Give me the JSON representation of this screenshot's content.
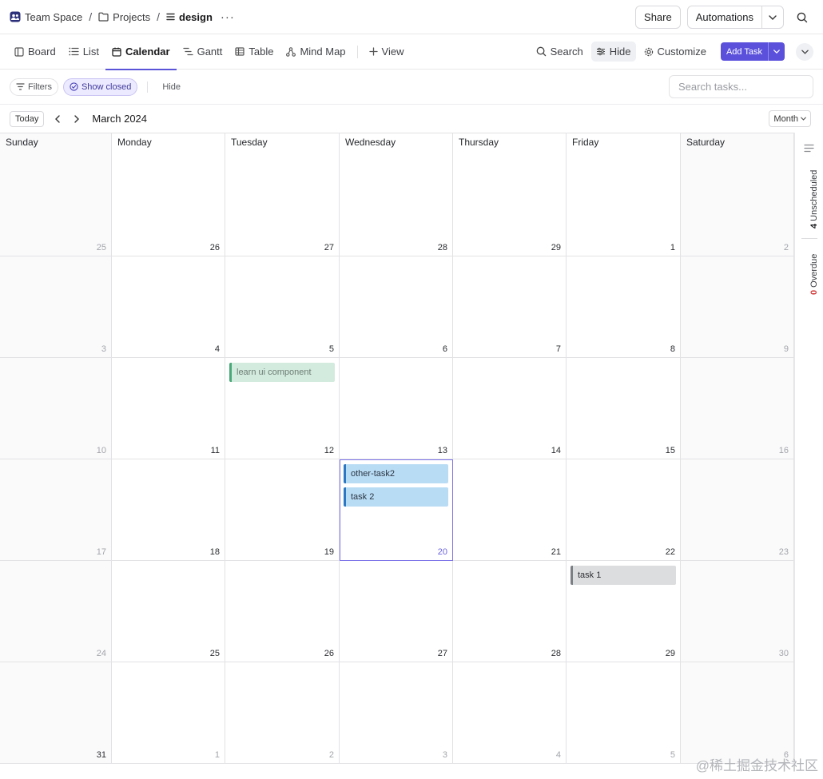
{
  "breadcrumb": {
    "space": "Team Space",
    "folder": "Projects",
    "list": "design",
    "separator": "/",
    "more": "···"
  },
  "topbar": {
    "share": "Share",
    "automations": "Automations"
  },
  "views": {
    "tabs": [
      "Board",
      "List",
      "Calendar",
      "Gantt",
      "Table",
      "Mind Map"
    ],
    "active": "Calendar",
    "add_view": "View"
  },
  "view_actions": {
    "search": "Search",
    "hide": "Hide",
    "customize": "Customize",
    "add_task": "Add Task"
  },
  "filters": {
    "filters": "Filters",
    "show_closed": "Show closed",
    "hide": "Hide",
    "search_placeholder": "Search tasks..."
  },
  "calendar": {
    "today_button": "Today",
    "title": "March 2024",
    "mode": "Month",
    "weekdays": [
      "Sunday",
      "Monday",
      "Tuesday",
      "Wednesday",
      "Thursday",
      "Friday",
      "Saturday"
    ],
    "weeks": [
      [
        "25",
        "26",
        "27",
        "28",
        "29",
        "1",
        "2"
      ],
      [
        "3",
        "4",
        "5",
        "6",
        "7",
        "8",
        "9"
      ],
      [
        "10",
        "11",
        "12",
        "13",
        "14",
        "15",
        "16"
      ],
      [
        "17",
        "18",
        "19",
        "20",
        "21",
        "22",
        "23"
      ],
      [
        "24",
        "25",
        "26",
        "27",
        "28",
        "29",
        "30"
      ],
      [
        "31",
        "1",
        "2",
        "3",
        "4",
        "5",
        "6"
      ]
    ],
    "events": {
      "tue_12": "learn ui component",
      "wed_20_a": "other-task2",
      "wed_20_b": "task 2",
      "fri_29": "task 1"
    }
  },
  "rail": {
    "unscheduled_count": "4",
    "unscheduled_label": "Unscheduled",
    "overdue_count": "0",
    "overdue_label": "Overdue"
  },
  "watermark": "@稀土掘金技术社区",
  "colors": {
    "accent": "#5b53d8",
    "event_green": "#d3eadf",
    "event_blue": "#b9dcf5",
    "event_gray": "#dcdddf"
  }
}
